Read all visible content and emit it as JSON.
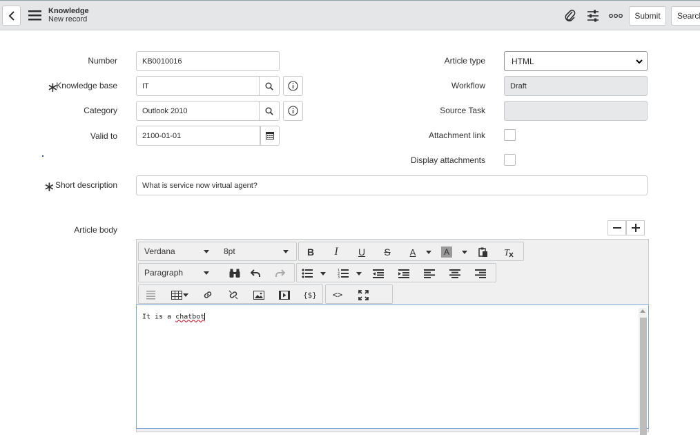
{
  "header": {
    "title": "Knowledge",
    "subtitle": "New record",
    "submit_label": "Submit",
    "search_label": "Search"
  },
  "form": {
    "number_label": "Number",
    "number_value": "KB0010016",
    "kb_label": "Knowledge base",
    "kb_value": "IT",
    "category_label": "Category",
    "category_value": "Outlook 2010",
    "valid_to_label": "Valid to",
    "valid_to_value": "2100-01-01",
    "article_type_label": "Article type",
    "article_type_value": "HTML",
    "workflow_label": "Workflow",
    "workflow_value": "Draft",
    "source_task_label": "Source Task",
    "source_task_value": "",
    "attachment_link_label": "Attachment link",
    "display_attachments_label": "Display attachments",
    "short_desc_label": "Short description",
    "short_desc_value": "What is service now virtual agent?",
    "article_body_label": "Article body",
    "required_mark": "∗"
  },
  "editor": {
    "font_family": "Verdana",
    "font_size": "8pt",
    "block_format": "Paragraph",
    "content_prefix": "It is a ",
    "content_misspelled": "chatbot"
  },
  "colors": {
    "header_bg": "#e4e6e7",
    "editor_focus_border": "#7aa7d8",
    "readonly_bg": "#e6e8ea"
  }
}
